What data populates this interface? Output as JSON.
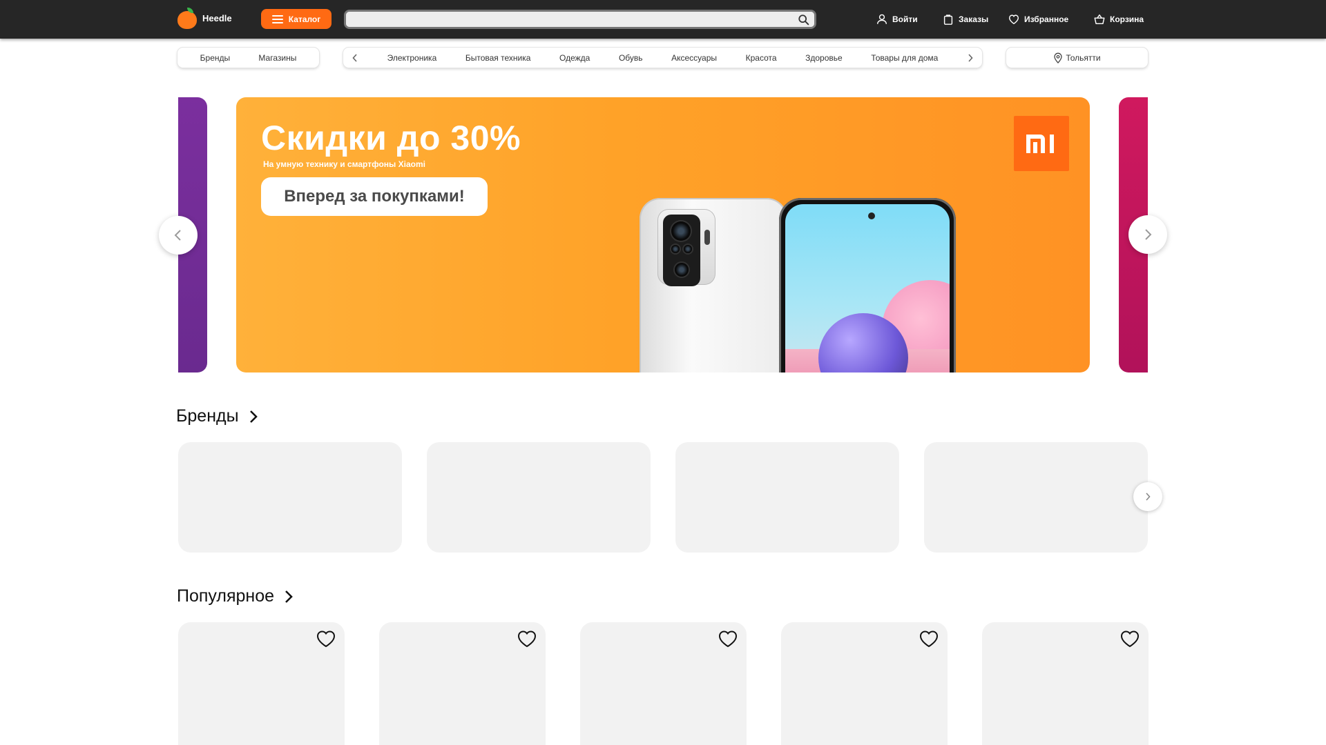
{
  "header": {
    "logo_text": "Heedle",
    "catalog_label": "Каталог",
    "search": {
      "value": "",
      "placeholder": ""
    },
    "nav": {
      "login": "Войти",
      "orders": "Заказы",
      "favorites": "Избранное",
      "cart": "Корзина"
    }
  },
  "subnav": {
    "left": [
      "Бренды",
      "Магазины"
    ],
    "categories": [
      "Электроника",
      "Бытовая техника",
      "Одежда",
      "Обувь",
      "Аксессуары",
      "Красота",
      "Здоровье",
      "Товары для дома"
    ],
    "city": "Тольятти"
  },
  "banner": {
    "title": "Скидки до 30%",
    "subtitle": "На умную технику и смартфоны Xiaomi",
    "cta": "Вперед за покупками!",
    "brand_logo": "mi-logo",
    "colors": {
      "start": "#ffb13a",
      "end": "#ff9224",
      "accent": "#ff6a13"
    }
  },
  "sections": {
    "brands": {
      "title": "Бренды",
      "card_count": 4
    },
    "popular": {
      "title": "Популярное",
      "card_count": 5
    }
  },
  "colors": {
    "header_bg": "#262626",
    "accent": "#ff6a13",
    "card_bg": "#f2f2f2"
  },
  "icons": [
    "user-icon",
    "bag-icon",
    "heart-icon",
    "basket-icon",
    "search-icon",
    "location-icon",
    "chevron-left-icon",
    "chevron-right-icon",
    "menu-icon"
  ]
}
